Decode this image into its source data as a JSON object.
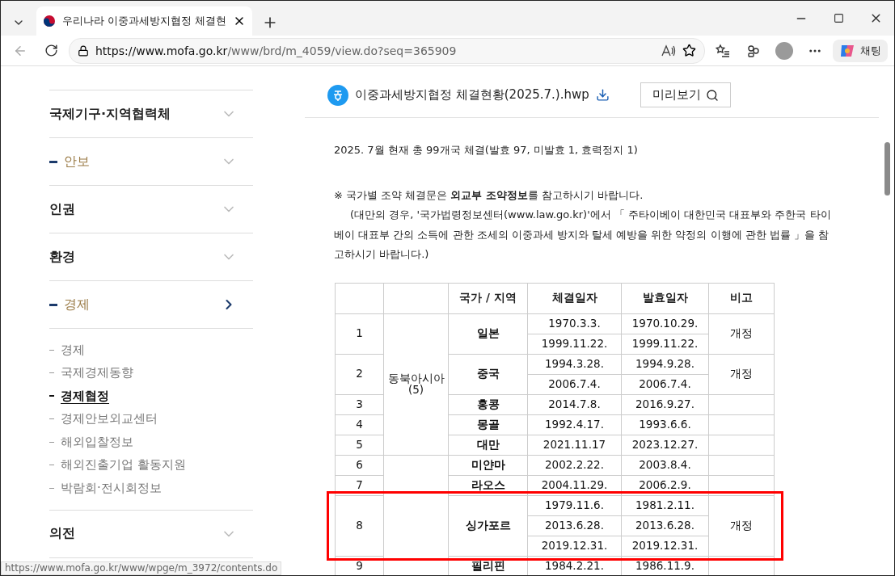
{
  "browser": {
    "tab_title": "우리나라 이중과세방지협정 체결현",
    "url_host": "https://www.mofa.go.kr",
    "url_path": "/www/brd/m_4059/view.do?seq=365909",
    "chat_label": "채팅",
    "status_url": "https://www.mofa.go.kr/www/wpge/m_3972/contents.do"
  },
  "sidebar": {
    "items": [
      {
        "label": "국제기구·지역협력체",
        "marked": false,
        "expanded": false
      },
      {
        "label": "안보",
        "marked": true,
        "expanded": false
      },
      {
        "label": "인권",
        "marked": false,
        "expanded": false
      },
      {
        "label": "환경",
        "marked": false,
        "expanded": false
      },
      {
        "label": "경제",
        "marked": true,
        "expanded": true,
        "children": [
          {
            "label": "경제",
            "selected": false
          },
          {
            "label": "국제경제동향",
            "selected": false
          },
          {
            "label": "경제협정",
            "selected": true
          },
          {
            "label": "경제안보외교센터",
            "selected": false
          },
          {
            "label": "해외입찰정보",
            "selected": false
          },
          {
            "label": "해외진출기업 활동지원",
            "selected": false
          },
          {
            "label": "박람회·전시회정보",
            "selected": false
          }
        ]
      },
      {
        "label": "의전",
        "marked": false,
        "expanded": false
      }
    ]
  },
  "attachment": {
    "file_name": "이중과세방지협정 체결현황(2025.7.).hwp",
    "preview_label": "미리보기"
  },
  "summary": "2025. 7월 현재 총 99개국 체결(발효 97, 미발효 1, 효력정지 1)",
  "note": "※ 국가별 조약 체결문은  **외교부 조약정보**를 참고하시기 바랍니다.",
  "note_detail": "(대만의 경우, '국가법령정보센터(www.law.go.kr)'에서 「 주타이베이 대한민국 대표부와 주한국 타이베이 대표부 간의 소득에 관한 조세의 이중과세 방지와 탈세 예방을 위한 약정의 이행에 관한 법률 」을 참고하시기 바랍니다.)",
  "table": {
    "columns": [
      "국가 / 지역",
      "체결일자",
      "발효일자",
      "비고"
    ],
    "groups": [
      {
        "region": "동북아시아 (5)",
        "rows": [
          {
            "no": "1",
            "country": "일본",
            "dates": [
              {
                "signed": "1970.3.3.",
                "effective": "1970.10.29."
              },
              {
                "signed": "1999.11.22.",
                "effective": "1999.11.22."
              }
            ],
            "note": "개정"
          },
          {
            "no": "2",
            "country": "중국",
            "dates": [
              {
                "signed": "1994.3.28.",
                "effective": "1994.9.28."
              },
              {
                "signed": "2006.7.4.",
                "effective": "2006.7.4."
              }
            ],
            "note": "개정"
          },
          {
            "no": "3",
            "country": "홍콩",
            "dates": [
              {
                "signed": "2014.7.8.",
                "effective": "2016.9.27."
              }
            ]
          },
          {
            "no": "4",
            "country": "몽골",
            "dates": [
              {
                "signed": "1992.4.17.",
                "effective": "1993.6.6."
              }
            ]
          },
          {
            "no": "5",
            "country": "대만",
            "dates": [
              {
                "signed": "2021.11.17",
                "effective": "2023.12.27."
              }
            ]
          }
        ]
      },
      {
        "rows": [
          {
            "no": "6",
            "country": "미얀마",
            "dates": [
              {
                "signed": "2002.2.22.",
                "effective": "2003.8.4."
              }
            ]
          },
          {
            "no": "7",
            "country": "라오스",
            "dates": [
              {
                "signed": "2004.11.29.",
                "effective": "2006.2.9."
              }
            ]
          },
          {
            "no": "8",
            "country": "싱가포르",
            "dates": [
              {
                "signed": "1979.11.6.",
                "effective": "1981.2.11."
              },
              {
                "signed": "2013.6.28.",
                "effective": "2013.6.28."
              },
              {
                "signed": "2019.12.31.",
                "effective": "2019.12.31."
              }
            ],
            "note": "개정",
            "highlighted": true
          },
          {
            "no": "9",
            "country": "필리핀",
            "dates": [
              {
                "signed": "1984.2.21.",
                "effective": "1986.11.9."
              }
            ]
          }
        ]
      }
    ]
  }
}
